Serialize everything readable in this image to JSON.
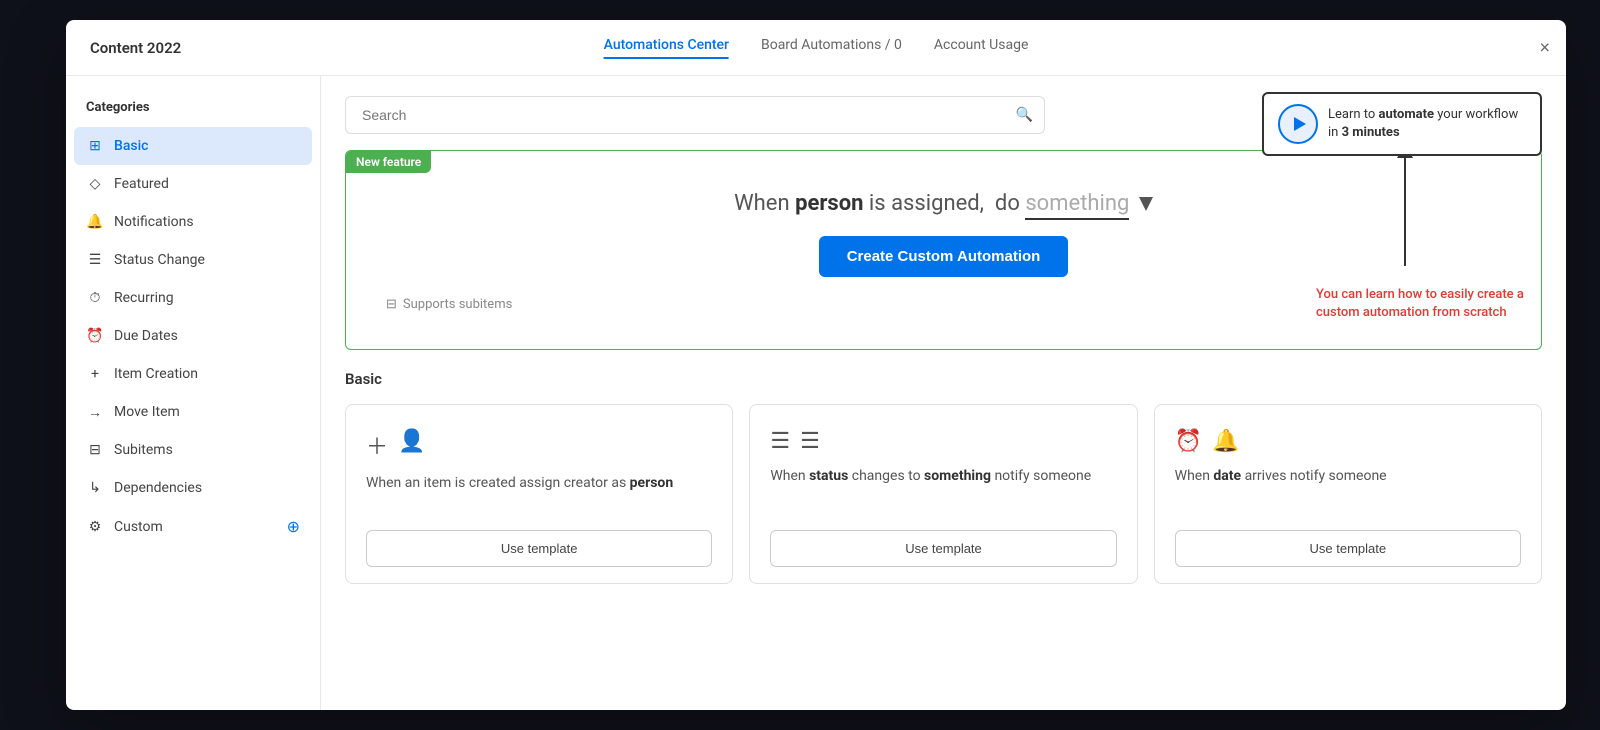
{
  "modal": {
    "title": "Content 2022",
    "close_label": "×",
    "tabs": [
      {
        "label": "Automations Center",
        "active": true
      },
      {
        "label": "Board Automations / 0",
        "active": false
      },
      {
        "label": "Account Usage",
        "active": false
      }
    ]
  },
  "sidebar": {
    "section_title": "Categories",
    "items": [
      {
        "label": "Basic",
        "icon": "⊞",
        "active": true
      },
      {
        "label": "Featured",
        "icon": "◇",
        "active": false
      },
      {
        "label": "Notifications",
        "icon": "🔔",
        "active": false
      },
      {
        "label": "Status Change",
        "icon": "☰",
        "active": false
      },
      {
        "label": "Recurring",
        "icon": "⏱",
        "active": false
      },
      {
        "label": "Due Dates",
        "icon": "⏰",
        "active": false
      },
      {
        "label": "Item Creation",
        "icon": "+",
        "active": false
      },
      {
        "label": "Move Item",
        "icon": "→",
        "active": false
      },
      {
        "label": "Subitems",
        "icon": "⊟",
        "active": false
      },
      {
        "label": "Dependencies",
        "icon": "↳",
        "active": false
      },
      {
        "label": "Custom",
        "icon": "⚙",
        "active": false,
        "has_plus": true
      }
    ]
  },
  "search": {
    "placeholder": "Search"
  },
  "video_box": {
    "text_prefix": "Learn to ",
    "text_bold": "automate",
    "text_suffix": " your workflow in ",
    "text_bold2": "3 minutes"
  },
  "arrow": {},
  "tooltip_note": "You can learn how to easily create a custom automation from scratch",
  "new_feature": {
    "badge": "New feature",
    "sentence_parts": [
      {
        "text": "When ",
        "bold": false
      },
      {
        "text": "person",
        "bold": true
      },
      {
        "text": " is assigned,  do ",
        "bold": false
      },
      {
        "text": "something",
        "bold": false,
        "dimmed": true
      }
    ],
    "create_btn_label": "Create Custom Automation",
    "subitems_label": "Supports subitems"
  },
  "basic_section": {
    "label": "Basic",
    "cards": [
      {
        "icons": [
          "＋👤"
        ],
        "description_parts": [
          {
            "text": "When an item is created assign creator as "
          },
          {
            "text": "person",
            "bold": true
          }
        ],
        "btn_label": "Use template"
      },
      {
        "icons": [
          "☰☰"
        ],
        "description_parts": [
          {
            "text": "When "
          },
          {
            "text": "status",
            "bold": true
          },
          {
            "text": " changes to "
          },
          {
            "text": "something",
            "bold": true
          },
          {
            "text": " notify someone"
          }
        ],
        "btn_label": "Use template"
      },
      {
        "icons": [
          "⏰🔔"
        ],
        "description_parts": [
          {
            "text": "When "
          },
          {
            "text": "date",
            "bold": true
          },
          {
            "text": " arrives "
          },
          {
            "text": "notify someone"
          }
        ],
        "btn_label": "Use template"
      }
    ]
  }
}
